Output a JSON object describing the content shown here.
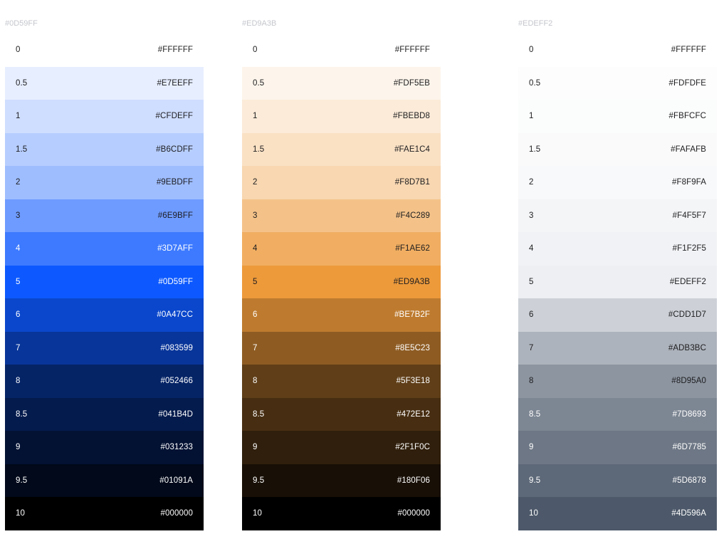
{
  "palettes": [
    {
      "name": "#0D59FF",
      "swatches": [
        {
          "step": "0",
          "hex": "#FFFFFF",
          "text": "#1d1d1f"
        },
        {
          "step": "0.5",
          "hex": "#E7EEFF",
          "text": "#1d1d1f"
        },
        {
          "step": "1",
          "hex": "#CFDEFF",
          "text": "#1d1d1f"
        },
        {
          "step": "1.5",
          "hex": "#B6CDFF",
          "text": "#1d1d1f"
        },
        {
          "step": "2",
          "hex": "#9EBDFF",
          "text": "#1d1d1f"
        },
        {
          "step": "3",
          "hex": "#6E9BFF",
          "text": "#1d1d1f"
        },
        {
          "step": "4",
          "hex": "#3D7AFF",
          "text": "#ffffff"
        },
        {
          "step": "5",
          "hex": "#0D59FF",
          "text": "#ffffff"
        },
        {
          "step": "6",
          "hex": "#0A47CC",
          "text": "#ffffff"
        },
        {
          "step": "7",
          "hex": "#083599",
          "text": "#ffffff"
        },
        {
          "step": "8",
          "hex": "#052466",
          "text": "#ffffff"
        },
        {
          "step": "8.5",
          "hex": "#041B4D",
          "text": "#ffffff"
        },
        {
          "step": "9",
          "hex": "#031233",
          "text": "#ffffff"
        },
        {
          "step": "9.5",
          "hex": "#01091A",
          "text": "#ffffff"
        },
        {
          "step": "10",
          "hex": "#000000",
          "text": "#ffffff"
        }
      ]
    },
    {
      "name": "#ED9A3B",
      "swatches": [
        {
          "step": "0",
          "hex": "#FFFFFF",
          "text": "#1d1d1f"
        },
        {
          "step": "0.5",
          "hex": "#FDF5EB",
          "text": "#1d1d1f"
        },
        {
          "step": "1",
          "hex": "#FBEBD8",
          "text": "#1d1d1f"
        },
        {
          "step": "1.5",
          "hex": "#FAE1C4",
          "text": "#1d1d1f"
        },
        {
          "step": "2",
          "hex": "#F8D7B1",
          "text": "#1d1d1f"
        },
        {
          "step": "3",
          "hex": "#F4C289",
          "text": "#1d1d1f"
        },
        {
          "step": "4",
          "hex": "#F1AE62",
          "text": "#1d1d1f"
        },
        {
          "step": "5",
          "hex": "#ED9A3B",
          "text": "#1d1d1f"
        },
        {
          "step": "6",
          "hex": "#BE7B2F",
          "text": "#ffffff"
        },
        {
          "step": "7",
          "hex": "#8E5C23",
          "text": "#ffffff"
        },
        {
          "step": "8",
          "hex": "#5F3E18",
          "text": "#ffffff"
        },
        {
          "step": "8.5",
          "hex": "#472E12",
          "text": "#ffffff"
        },
        {
          "step": "9",
          "hex": "#2F1F0C",
          "text": "#ffffff"
        },
        {
          "step": "9.5",
          "hex": "#180F06",
          "text": "#ffffff"
        },
        {
          "step": "10",
          "hex": "#000000",
          "text": "#ffffff"
        }
      ]
    },
    {
      "name": "#EDEFF2",
      "swatches": [
        {
          "step": "0",
          "hex": "#FFFFFF",
          "text": "#1d1d1f"
        },
        {
          "step": "0.5",
          "hex": "#FDFDFE",
          "text": "#1d1d1f"
        },
        {
          "step": "1",
          "hex": "#FBFCFC",
          "text": "#1d1d1f"
        },
        {
          "step": "1.5",
          "hex": "#FAFAFB",
          "text": "#1d1d1f"
        },
        {
          "step": "2",
          "hex": "#F8F9FA",
          "text": "#1d1d1f"
        },
        {
          "step": "3",
          "hex": "#F4F5F7",
          "text": "#1d1d1f"
        },
        {
          "step": "4",
          "hex": "#F1F2F5",
          "text": "#1d1d1f"
        },
        {
          "step": "5",
          "hex": "#EDEFF2",
          "text": "#1d1d1f"
        },
        {
          "step": "6",
          "hex": "#CDD1D7",
          "text": "#1d1d1f"
        },
        {
          "step": "7",
          "hex": "#ADB3BC",
          "text": "#1d1d1f"
        },
        {
          "step": "8",
          "hex": "#8D95A0",
          "text": "#1d1d1f"
        },
        {
          "step": "8.5",
          "hex": "#7D8693",
          "text": "#ffffff"
        },
        {
          "step": "9",
          "hex": "#6D7785",
          "text": "#ffffff"
        },
        {
          "step": "9.5",
          "hex": "#5D6878",
          "text": "#ffffff"
        },
        {
          "step": "10",
          "hex": "#4D596A",
          "text": "#ffffff"
        }
      ]
    }
  ]
}
